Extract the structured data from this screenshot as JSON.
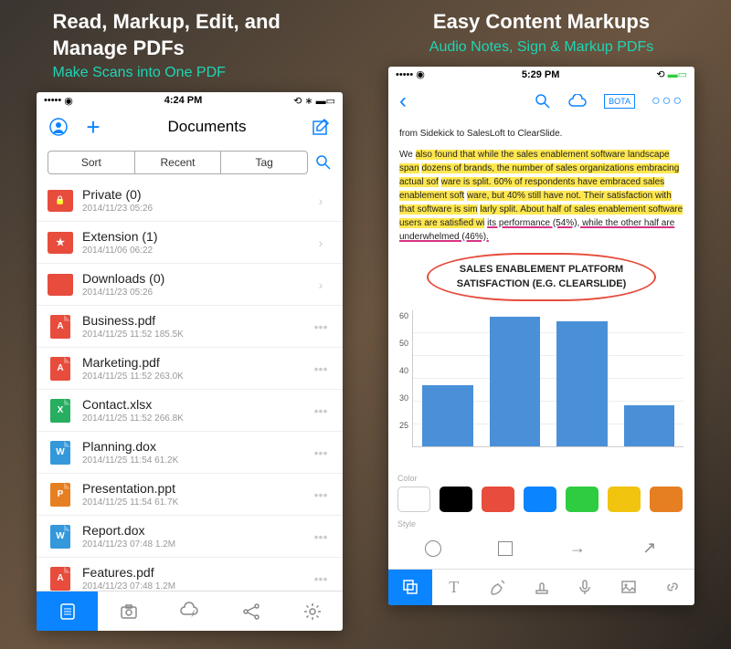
{
  "left": {
    "title": "Read, Markup, Edit, and Manage PDFs",
    "subtitle": "Make Scans into One PDF",
    "status": {
      "time": "4:24 PM"
    },
    "nav_title": "Documents",
    "filters": {
      "sort": "Sort",
      "recent": "Recent",
      "tag": "Tag"
    },
    "items": [
      {
        "type": "folder-locked",
        "name": "Private (0)",
        "meta": "2014/11/23 05:26",
        "action": "chevron"
      },
      {
        "type": "folder-star",
        "name": "Extension (1)",
        "meta": "2014/11/06 06:22",
        "action": "chevron"
      },
      {
        "type": "folder",
        "name": "Downloads (0)",
        "meta": "2014/11/23 05:26",
        "action": "chevron"
      },
      {
        "type": "pdf",
        "letter": "A",
        "name": "Business.pdf",
        "meta": "2014/11/25 11:52   185.5K",
        "action": "dots"
      },
      {
        "type": "pdf",
        "letter": "A",
        "name": "Marketing.pdf",
        "meta": "2014/11/25 11:52   263.0K",
        "action": "dots"
      },
      {
        "type": "xls",
        "letter": "X",
        "name": "Contact.xlsx",
        "meta": "2014/11/25 11:52   266.8K",
        "action": "dots"
      },
      {
        "type": "doc",
        "letter": "W",
        "name": "Planning.dox",
        "meta": "2014/11/25 11:54   61.2K",
        "action": "dots"
      },
      {
        "type": "ppt",
        "letter": "P",
        "name": "Presentation.ppt",
        "meta": "2014/11/25 11:54   61.7K",
        "action": "dots"
      },
      {
        "type": "doc",
        "letter": "W",
        "name": "Report.dox",
        "meta": "2014/11/23 07:48   1.2M",
        "action": "dots"
      },
      {
        "type": "pdf",
        "letter": "A",
        "name": "Features.pdf",
        "meta": "2014/11/23 07:48   1.2M",
        "action": "dots"
      }
    ]
  },
  "right": {
    "title": "Easy Content Markups",
    "subtitle": "Audio Notes, Sign & Markup PDFs",
    "status": {
      "time": "5:29 PM"
    },
    "bota": "BOTA",
    "text_line1": "from Sidekick to SalesLoft to ClearSlide.",
    "text_p1a": "We ",
    "text_p1b": "also found that while the sales enablement software landscape span",
    "text_p1c": "dozens of brands, the number of sales organizations embracing actual sof",
    "text_p1d": "ware is split. 60% of respondents have embraced sales enablement soft",
    "text_p1e": "ware, but 40% still have not. Their satisfaction with that software is sim",
    "text_p1f": "larly split. About half of sales enablement software users are satisfied wi",
    "text_p1g": "its performance (54%), while the other half are underwhelmed (46%).",
    "chart_title1": "SALES ENABLEMENT PLATFORM",
    "chart_title2": "SATISFACTION (E.G. CLEARSLIDE)",
    "color_label": "Color",
    "style_label": "Style",
    "colors": [
      "#ffffff",
      "#000000",
      "#e74c3c",
      "#0a84ff",
      "#2ecc40",
      "#f1c40f",
      "#e67e22"
    ]
  },
  "chart_data": {
    "type": "bar",
    "title": "SALES ENABLEMENT PLATFORM SATISFACTION (E.G. CLEARSLIDE)",
    "categories": [
      "",
      "",
      "",
      ""
    ],
    "values": [
      27,
      57,
      55,
      18
    ],
    "ylim": [
      0,
      60
    ],
    "yticks": [
      60,
      50,
      40,
      30,
      25,
      0
    ],
    "xlabel": "",
    "ylabel": ""
  }
}
